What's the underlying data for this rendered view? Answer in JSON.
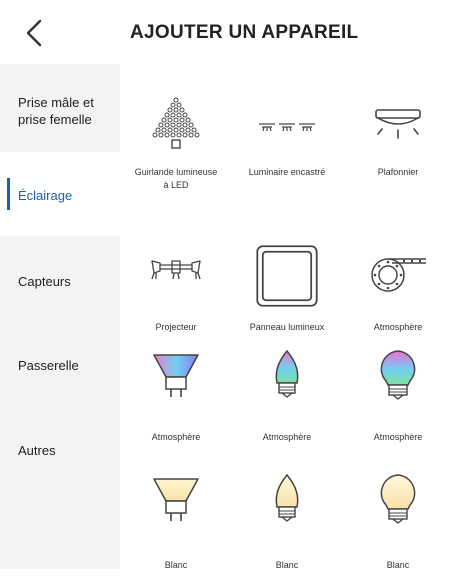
{
  "header": {
    "title": "AJOUTER UN APPAREIL"
  },
  "sidebar": {
    "items": [
      {
        "label": "Prise mâle et\nprise femelle"
      },
      {
        "label": "Éclairage"
      },
      {
        "label": "Capteurs"
      },
      {
        "label": "Passerelle"
      },
      {
        "label": "Autres"
      }
    ],
    "active_index": 1
  },
  "devices": [
    {
      "label": "Guirlande lumineuse\nà LED",
      "icon": "led-string-icon"
    },
    {
      "label": "Luminaire encastré",
      "icon": "recessed-light-icon"
    },
    {
      "label": "Plafonnier",
      "icon": "ceiling-light-icon"
    },
    {
      "label": "Projecteur",
      "icon": "spotlight-bar-icon"
    },
    {
      "label": "Panneau lumineux",
      "icon": "light-panel-icon"
    },
    {
      "label": "Atmosphère",
      "icon": "led-strip-reel-icon"
    },
    {
      "label": "Atmosphère",
      "icon": "gu10-rgb-bulb-icon"
    },
    {
      "label": "Atmosphère",
      "icon": "candle-rgb-bulb-icon"
    },
    {
      "label": "Atmosphère",
      "icon": "classic-rgb-bulb-icon"
    },
    {
      "label": "Blanc",
      "icon": "gu10-white-bulb-icon"
    },
    {
      "label": "Blanc",
      "icon": "candle-white-bulb-icon"
    },
    {
      "label": "Blanc",
      "icon": "classic-white-bulb-icon"
    }
  ],
  "colors": {
    "accent": "#1f5fa8",
    "sidebar_bg": "#f3f3f3"
  }
}
